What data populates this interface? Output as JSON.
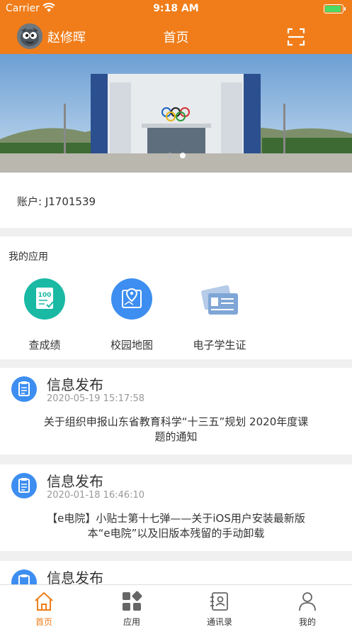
{
  "status_bar": {
    "carrier": "Carrier",
    "time": "9:18 AM",
    "wifi_icon": "wifi-icon",
    "battery_icon": "battery-icon",
    "battery_color": "#4cd964"
  },
  "nav_bar": {
    "username": "赵修晖",
    "title": "首页",
    "scan_icon": "scan-qr-icon",
    "background": "#f07d1a"
  },
  "banner": {
    "image": "stadium-photo",
    "active_slide_index": 1,
    "slides": 2
  },
  "account": {
    "text": "账户: J1701539"
  },
  "my_apps": {
    "title": "我的应用",
    "items": [
      {
        "label": "查成绩",
        "icon": "score-100-icon",
        "color": "#19b9a4"
      },
      {
        "label": "校园地图",
        "icon": "map-pin-icon",
        "color": "#3d8ef0"
      },
      {
        "label": "电子学生证",
        "icon": "student-card-icon",
        "color": "#7fa6d6"
      }
    ]
  },
  "posts": [
    {
      "title": "信息发布",
      "time": "2020-05-19 15:17:58",
      "line1": "关于组织申报山东省教育科学“十三五”规划 2020年度课",
      "line2": "题的通知"
    },
    {
      "title": "信息发布",
      "time": "2020-01-18 16:46:10",
      "line1": "【e电院】小贴士第十七弹——关于iOS用户安装最新版",
      "line2": "本“e电院”以及旧版本残留的手动卸载"
    },
    {
      "title": "信息发布"
    }
  ],
  "tab_bar": {
    "active_color": "#f07d1a",
    "tabs": [
      {
        "label": "首页",
        "icon": "home-icon",
        "active": true
      },
      {
        "label": "应用",
        "icon": "apps-grid-icon",
        "active": false
      },
      {
        "label": "通讯录",
        "icon": "contacts-icon",
        "active": false
      },
      {
        "label": "我的",
        "icon": "profile-icon",
        "active": false
      }
    ]
  }
}
